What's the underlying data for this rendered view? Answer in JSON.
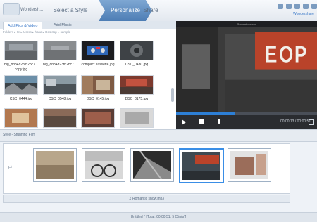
{
  "header": {
    "app_name": "Wondersh...",
    "steps": [
      "Select a Style",
      "Personalize",
      "Share"
    ],
    "brand": "Wondershare"
  },
  "media": {
    "tabs": [
      "Add Pics & Video",
      "Add Music"
    ],
    "crumb": "Folders ▸  C:  ▸  Users ▸  hana ▸  Desktop ▸  sample",
    "items": [
      {
        "caption": "big_8b84d23fb2bc7...",
        "caption2": "copy.jpg"
      },
      {
        "caption": "big_8b84d23fb2bc7...",
        "caption2": "jpg"
      },
      {
        "caption": "compact cassette.jpg",
        "caption2": ""
      },
      {
        "caption": "CSC_0430.jpg",
        "caption2": ""
      },
      {
        "caption": "CSC_0444.jpg",
        "caption2": ""
      },
      {
        "caption": "CSC_0548.jpg",
        "caption2": ""
      },
      {
        "caption": "DSC_0145.jpg",
        "caption2": ""
      },
      {
        "caption": "DSC_0175.jpg",
        "caption2": ""
      }
    ]
  },
  "preview": {
    "title": "Romantic show",
    "time": "00:00:13 / 00:00:51",
    "progress": 0.42
  },
  "style_bar": {
    "label": "Style - Stunning Film"
  },
  "timeline": {
    "clips": 5
  },
  "music": {
    "label": "♫ Romantic show.mp3"
  },
  "status": {
    "text": "Untitled *  [Total: 00:00:51, 5 Clip(s)]"
  },
  "colors": {
    "accent": "#3a8ee6",
    "header_active": "#4d7db5"
  }
}
